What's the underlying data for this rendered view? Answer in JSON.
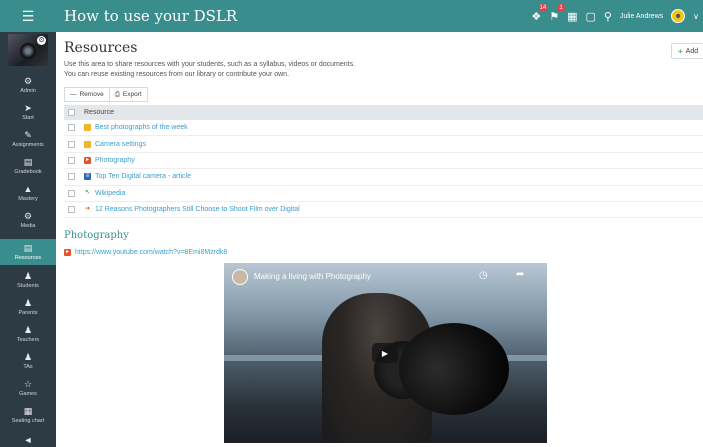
{
  "header": {
    "title": "How to use your DSLR",
    "user_name": "Julie Andrews",
    "notifications": [
      {
        "icon": "puzzle-icon",
        "badge": "14"
      },
      {
        "icon": "bell-icon",
        "badge": "1"
      },
      {
        "icon": "grid-icon",
        "badge": ""
      },
      {
        "icon": "book-icon",
        "badge": ""
      },
      {
        "icon": "search-icon",
        "badge": ""
      }
    ]
  },
  "sidebar": {
    "items": [
      {
        "label": "Admin",
        "icon": "gear-icon"
      },
      {
        "label": "Start",
        "icon": "arrow-icon"
      },
      {
        "label": "Assignments",
        "icon": "assignments-icon"
      },
      {
        "label": "Gradebook",
        "icon": "gradebook-icon"
      },
      {
        "label": "Mastery",
        "icon": "mastery-icon"
      },
      {
        "label": "Media",
        "icon": "media-icon"
      },
      {
        "label": "Resources",
        "icon": "resources-icon",
        "active": true
      },
      {
        "label": "Students",
        "icon": "person-icon"
      },
      {
        "label": "Parents",
        "icon": "person-icon"
      },
      {
        "label": "Teachers",
        "icon": "person-icon"
      },
      {
        "label": "TAs",
        "icon": "person-icon"
      },
      {
        "label": "Games",
        "icon": "trophy-icon"
      },
      {
        "label": "Seating chart",
        "icon": "seating-icon"
      },
      {
        "label": "",
        "icon": "megaphone-icon"
      }
    ]
  },
  "main": {
    "title": "Resources",
    "intro_line1": "Use this area to share resources with your students, such as a syllabus, videos or documents.",
    "intro_line2": "You can reuse existing resources from our library or contribute your own.",
    "add_label": "Add",
    "toolbar": {
      "remove_label": "Remove",
      "export_label": "Export"
    },
    "table": {
      "header": "Resource",
      "rows": [
        {
          "type": "folder",
          "label": "Best photographs of the week"
        },
        {
          "type": "folder",
          "label": "Camera settings"
        },
        {
          "type": "youtube",
          "label": "Photography"
        },
        {
          "type": "doc",
          "label": "Top Ten Digital camera - article"
        },
        {
          "type": "wiki",
          "label": "Wikipedia"
        },
        {
          "type": "link",
          "label": "12 Reasons Photographers Still Choose to Shoot Film over Digital"
        }
      ]
    },
    "section": {
      "title": "Photography",
      "url": "https://www.youtube.com/watch?v=8Emi8Mzrdk8"
    },
    "video": {
      "title": "Making a living with Photography"
    }
  }
}
